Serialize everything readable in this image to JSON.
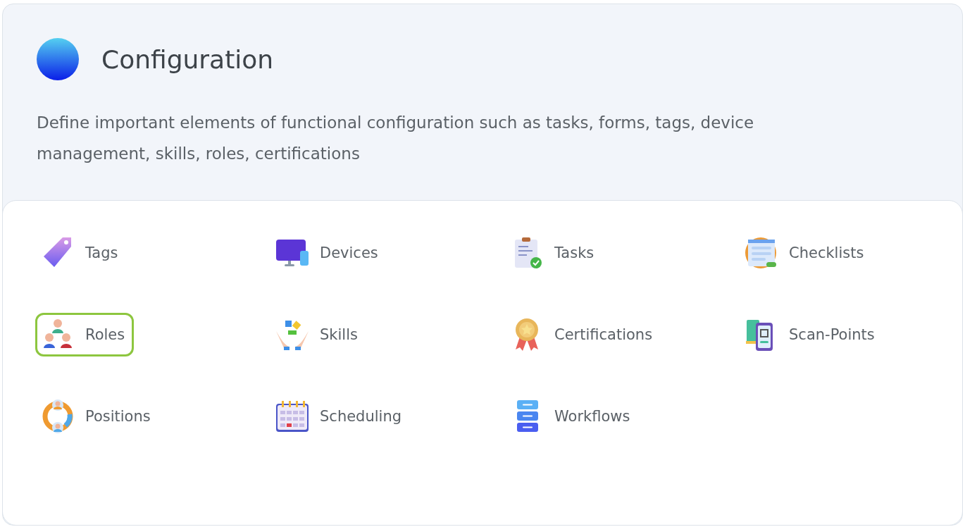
{
  "header": {
    "title": "Configuration",
    "description": "Define important elements of functional configuration such as tasks, forms, tags, device management, skills, roles, certifications"
  },
  "items": [
    {
      "label": "Tags",
      "kind": "tag",
      "selected": false
    },
    {
      "label": "Devices",
      "kind": "monitor",
      "selected": false
    },
    {
      "label": "Tasks",
      "kind": "clipboard",
      "selected": false
    },
    {
      "label": "Checklists",
      "kind": "form",
      "selected": false
    },
    {
      "label": "Roles",
      "kind": "people",
      "selected": true
    },
    {
      "label": "Skills",
      "kind": "puzzle",
      "selected": false
    },
    {
      "label": "Certifications",
      "kind": "medal",
      "selected": false
    },
    {
      "label": "Scan-Points",
      "kind": "phone",
      "selected": false
    },
    {
      "label": "Positions",
      "kind": "cycle",
      "selected": false
    },
    {
      "label": "Scheduling",
      "kind": "calendar",
      "selected": false
    },
    {
      "label": "Workflows",
      "kind": "stack",
      "selected": false
    }
  ]
}
